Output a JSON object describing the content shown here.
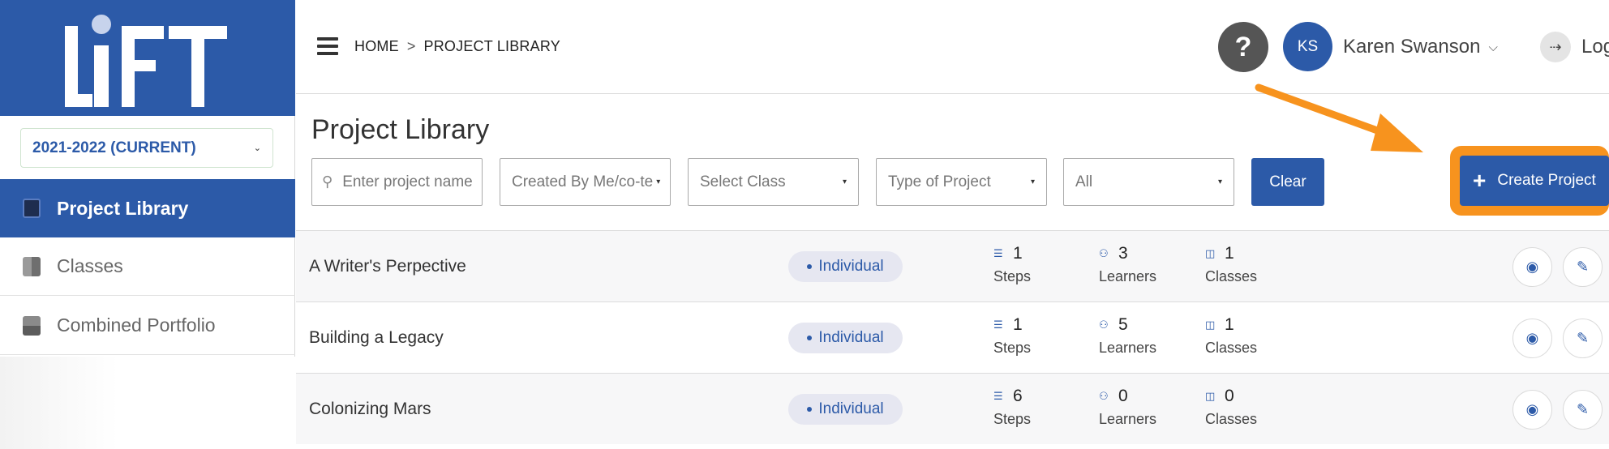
{
  "sidebar": {
    "logo_text": "LiFT",
    "year_select": "2021-2022 (CURRENT)",
    "items": [
      {
        "label": "Project Library",
        "icon": "project-library-icon",
        "active": true
      },
      {
        "label": "Classes",
        "icon": "book-icon",
        "active": false
      },
      {
        "label": "Combined Portfolio",
        "icon": "portfolio-icon",
        "active": false
      }
    ]
  },
  "header": {
    "breadcrumb": [
      "HOME",
      ">",
      "PROJECT LIBRARY"
    ],
    "help_label": "?",
    "avatar_initials": "KS",
    "user_name": "Karen Swanson",
    "logout_label": "Log"
  },
  "main": {
    "title": "Project Library",
    "filters": {
      "search_placeholder": "Enter project name",
      "created_by": "Created By Me/co-te",
      "class": "Select Class",
      "type": "Type of Project",
      "status": "All"
    },
    "clear_label": "Clear",
    "create_label": "Create Project"
  },
  "projects": [
    {
      "name": "A Writer's Perpective",
      "type": "Individual",
      "steps": "1",
      "learners": "3",
      "classes": "1"
    },
    {
      "name": "Building a Legacy",
      "type": "Individual",
      "steps": "1",
      "learners": "5",
      "classes": "1"
    },
    {
      "name": "Colonizing Mars",
      "type": "Individual",
      "steps": "6",
      "learners": "0",
      "classes": "0"
    }
  ],
  "labels": {
    "steps": "Steps",
    "learners": "Learners",
    "classes": "Classes"
  },
  "colors": {
    "brand": "#2c5aa8",
    "highlight": "#f7931e"
  }
}
